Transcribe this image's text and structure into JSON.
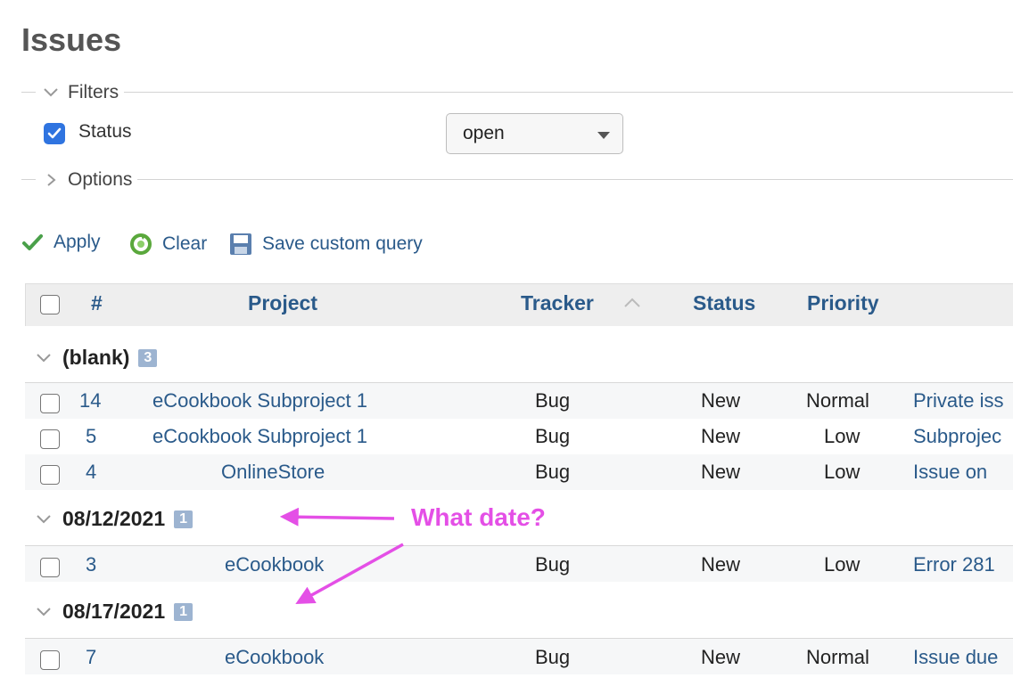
{
  "page": {
    "title": "Issues"
  },
  "filters": {
    "legend": "Filters",
    "status_label": "Status",
    "status_checked": true,
    "status_value": "open"
  },
  "options": {
    "legend": "Options"
  },
  "actions": {
    "apply": "Apply",
    "clear": "Clear",
    "save": "Save custom query"
  },
  "table": {
    "columns": {
      "id": "#",
      "project": "Project",
      "tracker": "Tracker",
      "status": "Status",
      "priority": "Priority"
    },
    "groups": [
      {
        "title": "(blank)",
        "count": "3",
        "rows": [
          {
            "id": "14",
            "project": "eCookbook Subproject 1",
            "tracker": "Bug",
            "status": "New",
            "priority": "Normal",
            "subject": "Private iss"
          },
          {
            "id": "5",
            "project": "eCookbook Subproject 1",
            "tracker": "Bug",
            "status": "New",
            "priority": "Low",
            "subject": "Subprojec"
          },
          {
            "id": "4",
            "project": "OnlineStore",
            "tracker": "Bug",
            "status": "New",
            "priority": "Low",
            "subject": "Issue on"
          }
        ]
      },
      {
        "title": "08/12/2021",
        "count": "1",
        "rows": [
          {
            "id": "3",
            "project": "eCookbook",
            "tracker": "Bug",
            "status": "New",
            "priority": "Low",
            "subject": "Error 281"
          }
        ]
      },
      {
        "title": "08/17/2021",
        "count": "1",
        "rows": [
          {
            "id": "7",
            "project": "eCookbook",
            "tracker": "Bug",
            "status": "New",
            "priority": "Normal",
            "subject": "Issue due"
          }
        ]
      }
    ]
  },
  "annotation": {
    "text": "What date?",
    "color": "#e44fe6"
  },
  "colors": {
    "link": "#2a5a8a",
    "checkbox": "#2f74e0",
    "badge": "#9db4d1",
    "header_bg": "#eeeeee"
  }
}
